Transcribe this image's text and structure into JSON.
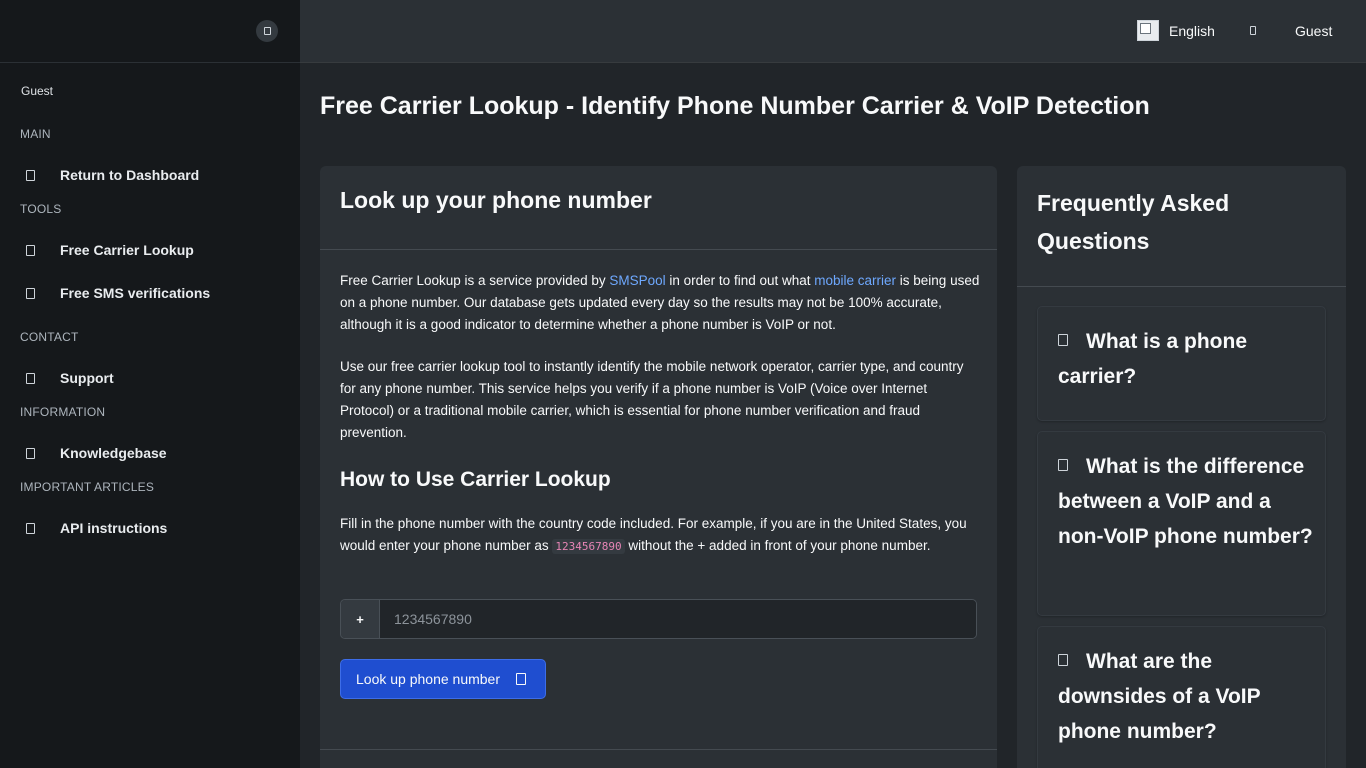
{
  "sidebar": {
    "user": "Guest",
    "sections": {
      "main": "MAIN",
      "tools": "TOOLS",
      "contact": "CONTACT",
      "information": "INFORMATION",
      "important": "IMPORTANT ARTICLES"
    },
    "items": [
      {
        "label": "Return to Dashboard"
      },
      {
        "label": "Free Carrier Lookup"
      },
      {
        "label": "Free SMS verifications"
      },
      {
        "label": "Support"
      },
      {
        "label": "Knowledgebase"
      },
      {
        "label": "API instructions"
      }
    ]
  },
  "topbar": {
    "language": "English",
    "user": "Guest"
  },
  "page": {
    "title": "Free Carrier Lookup - Identify Phone Number Carrier & VoIP Detection"
  },
  "main_card": {
    "header": "Look up your phone number",
    "p1_before": "Free Carrier Lookup is a service provided by ",
    "p1_link1": "SMSPool",
    "p1_middle": " in order to find out what ",
    "p1_link2": "mobile carrier",
    "p1_after": " is being used on a phone number. Our database gets updated every day so the results may not be 100% accurate, although it is a good indicator to determine whether a phone number is VoIP or not.",
    "p2": "Use our free carrier lookup tool to instantly identify the mobile network operator, carrier type, and country for any phone number. This service helps you verify if a phone number is VoIP (Voice over Internet Protocol) or a traditional mobile carrier, which is essential for phone number verification and fraud prevention.",
    "howto_title": "How to Use Carrier Lookup",
    "p3_before": "Fill in the phone number with the country code included. For example, if you are in the United States, you would enter your phone number as ",
    "p3_code": "1234567890",
    "p3_after": " without the + added in front of your phone number.",
    "input_prefix": "+",
    "input_placeholder": "1234567890",
    "button_label": "Look up phone number"
  },
  "faq_card": {
    "header": "Frequently Asked Questions",
    "items": [
      {
        "question": "What is a phone carrier?"
      },
      {
        "question": "What is the difference between a VoIP and a non-VoIP phone number?"
      },
      {
        "question": "What are the downsides of a VoIP phone number?"
      }
    ]
  }
}
